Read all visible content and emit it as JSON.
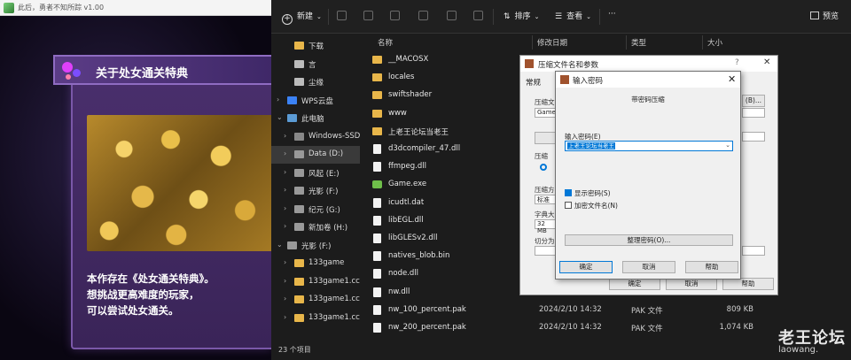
{
  "game": {
    "window_title": "此后，勇者不知所踪 v1.00",
    "banner_title": "关于处女通关特典",
    "desc_lines": [
      "本作存在《处女通关特典》。",
      "想挑战更高难度的玩家，",
      "可以尝试处女通关。"
    ]
  },
  "explorer": {
    "toolbar": {
      "new_label": "新建",
      "sort_label": "排序",
      "view_label": "查看",
      "more_label": "···",
      "preview_label": "预览"
    },
    "nav": [
      {
        "label": "下载",
        "chev": ""
      },
      {
        "label": "言",
        "chev": ""
      },
      {
        "label": "尘缘",
        "chev": ""
      },
      {
        "label": "WPS云盘",
        "chev": "›"
      },
      {
        "label": "此电脑",
        "chev": "⌄"
      },
      {
        "label": "Windows-SSD",
        "chev": "›"
      },
      {
        "label": "Data (D:)",
        "chev": "›"
      },
      {
        "label": "风起 (E:)",
        "chev": "›"
      },
      {
        "label": "光影 (F:)",
        "chev": "›"
      },
      {
        "label": "纪元 (G:)",
        "chev": "›"
      },
      {
        "label": "新加卷 (H:)",
        "chev": "›"
      },
      {
        "label": "光影 (F:)",
        "chev": "⌄"
      },
      {
        "label": "133game",
        "chev": "›"
      },
      {
        "label": "133game1.cc",
        "chev": "›"
      },
      {
        "label": "133game1.cc",
        "chev": "›"
      },
      {
        "label": "133game1.cc",
        "chev": "›"
      }
    ],
    "headers": {
      "name": "名称",
      "date": "修改日期",
      "type": "类型",
      "size": "大小"
    },
    "files": [
      {
        "name": "__MACOSX",
        "date": "",
        "type": "",
        "size": "",
        "kind": "folder"
      },
      {
        "name": "locales",
        "date": "",
        "type": "",
        "size": "",
        "kind": "folder"
      },
      {
        "name": "swiftshader",
        "date": "",
        "type": "",
        "size": "",
        "kind": "folder"
      },
      {
        "name": "www",
        "date": "",
        "type": "",
        "size": "",
        "kind": "folder"
      },
      {
        "name": "上老王论坛当老王",
        "date": "",
        "type": "",
        "size": "",
        "kind": "folder"
      },
      {
        "name": "d3dcompiler_47.dll",
        "date": "",
        "type": "",
        "size": "",
        "kind": "file"
      },
      {
        "name": "ffmpeg.dll",
        "date": "",
        "type": "",
        "size": "",
        "kind": "file"
      },
      {
        "name": "Game.exe",
        "date": "",
        "type": "",
        "size": "",
        "kind": "exe"
      },
      {
        "name": "icudtl.dat",
        "date": "",
        "type": "",
        "size": "",
        "kind": "file"
      },
      {
        "name": "libEGL.dll",
        "date": "",
        "type": "",
        "size": "",
        "kind": "file"
      },
      {
        "name": "libGLESv2.dll",
        "date": "",
        "type": "",
        "size": "",
        "kind": "file"
      },
      {
        "name": "natives_blob.bin",
        "date": "",
        "type": "",
        "size": "",
        "kind": "file"
      },
      {
        "name": "node.dll",
        "date": "",
        "type": "",
        "size": "",
        "kind": "file"
      },
      {
        "name": "nw.dll",
        "date": "",
        "type": "",
        "size": "",
        "kind": "file"
      },
      {
        "name": "nw_100_percent.pak",
        "date": "2024/2/10 14:32",
        "type": "PAK 文件",
        "size": "809 KB",
        "kind": "file"
      },
      {
        "name": "nw_200_percent.pak",
        "date": "2024/2/10 14:32",
        "type": "PAK 文件",
        "size": "1,074 KB",
        "kind": "file"
      }
    ],
    "status": "23 个项目"
  },
  "archive": {
    "title": "压缩文件名和参数",
    "tab": "常规",
    "l1": "压缩文",
    "f1": "Game.e",
    "l2": "压缩",
    "l3": "压缩方",
    "f3": "标准",
    "l4": "字典大",
    "f4": "32 MB",
    "l5": "切分为",
    "ok": "确定",
    "cancel": "取消",
    "help": "帮助",
    "browse": "(B)..."
  },
  "password": {
    "title": "输入密码",
    "subtitle": "带密码压缩",
    "input_label": "输入密码(E)",
    "value": "上老王论坛当老王",
    "show_pwd": "显示密码(S)",
    "encrypt_names": "加密文件名(N)",
    "manage": "整理密码(O)...",
    "ok": "确定",
    "cancel": "取消",
    "help": "帮助"
  },
  "watermark": {
    "cn": "老王论坛",
    "en": "laowang."
  }
}
